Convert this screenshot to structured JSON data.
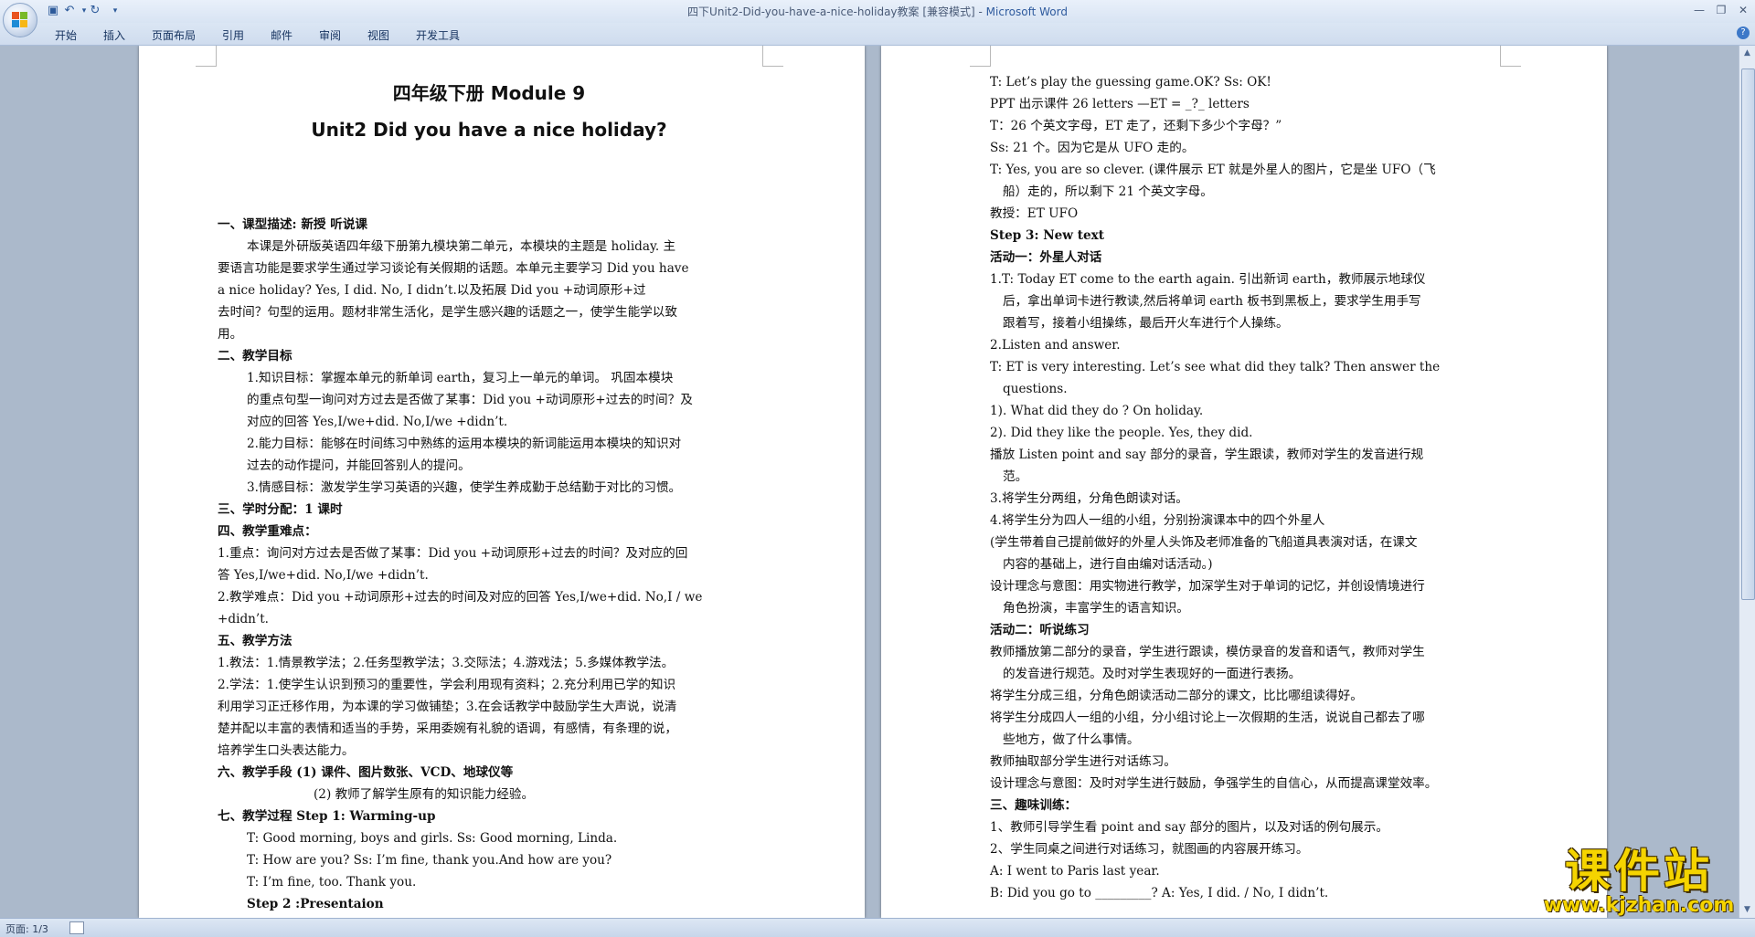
{
  "window": {
    "title": "四下Unit2-Did-you-have-a-nice-holiday教案 [兼容模式] - ",
    "app_name": "Microsoft Word"
  },
  "ribbon": {
    "tabs": [
      "开始",
      "插入",
      "页面布局",
      "引用",
      "邮件",
      "审阅",
      "视图",
      "开发工具"
    ]
  },
  "status": {
    "page_indicator": "页面: 1/3"
  },
  "watermark": {
    "text": "课件站",
    "url": "www.kjzhan.com"
  },
  "page1": {
    "title1": "四年级下册 Module 9",
    "title2": "Unit2 Did you have a nice holiday?",
    "lines": [
      {
        "t": "一、课型描述: 新授 听说课",
        "cls": "bold"
      },
      {
        "t": "本课是外研版英语四年级下册第九模块第二单元，本模块的主题是 holiday. 主",
        "cls": "indent1"
      },
      {
        "t": "要语言功能是要求学生通过学习谈论有关假期的话题。本单元主要学习 Did you have",
        "cls": ""
      },
      {
        "t": "a nice holiday?  Yes, I did.  No, I didn’t.以及拓展 Did you +动词原形+过",
        "cls": ""
      },
      {
        "t": "去时间？句型的运用。题材非常生活化，是学生感兴趣的话题之一，使学生能学以致",
        "cls": ""
      },
      {
        "t": "用。",
        "cls": ""
      },
      {
        "t": "二、教学目标",
        "cls": "bold"
      },
      {
        "t": "1.知识目标：掌握本单元的新单词 earth，复习上一单元的单词。  巩固本模块",
        "cls": "indent2"
      },
      {
        "t": "的重点句型一询问对方过去是否做了某事：Did you +动词原形+过去的时间？及",
        "cls": "indent2"
      },
      {
        "t": "对应的回答 Yes,I/we+did. No,I/we +didn’t.",
        "cls": "indent2"
      },
      {
        "t": "2.能力目标：能够在时间练习中熟练的运用本模块的新词能运用本模块的知识对",
        "cls": "indent2"
      },
      {
        "t": "过去的动作提问，并能回答别人的提问。",
        "cls": "indent2"
      },
      {
        "t": "3.情感目标：激发学生学习英语的兴趣，使学生养成勤于总结勤于对比的习惯。",
        "cls": "indent2"
      },
      {
        "t": "三、学时分配：1 课时",
        "cls": "bold"
      },
      {
        "t": "四、教学重难点：",
        "cls": "bold"
      },
      {
        "t": "1.重点：询问对方过去是否做了某事：Did you +动词原形+过去的时间？及对应的回",
        "cls": ""
      },
      {
        "t": "答 Yes,I/we+did. No,I/we +didn’t.",
        "cls": ""
      },
      {
        "t": "2.教学难点：Did you +动词原形+过去的时间及对应的回答 Yes,I/we+did. No,I / we",
        "cls": ""
      },
      {
        "t": "+didn’t.",
        "cls": ""
      },
      {
        "t": "五、教学方法",
        "cls": "bold"
      },
      {
        "t": "1.教法：1.情景教学法；2.任务型教学法；3.交际法；4.游戏法；5.多媒体教学法。",
        "cls": ""
      },
      {
        "t": "2.学法：1.使学生认识到预习的重要性，学会利用现有资料；2.充分利用已学的知识",
        "cls": ""
      },
      {
        "t": "利用学习正迁移作用，为本课的学习做铺垫；3.在会话教学中鼓励学生大声说，说清",
        "cls": ""
      },
      {
        "t": "楚并配以丰富的表情和适当的手势，采用委婉有礼貌的语调，有感情，有条理的说，",
        "cls": ""
      },
      {
        "t": "培养学生口头表达能力。",
        "cls": ""
      },
      {
        "t": "六、教学手段 (1) 课件、图片数张、VCD、地球仪等",
        "cls": "bold"
      },
      {
        "t": "(2) 教师了解学生原有的知识能力经验。",
        "cls": "indent3"
      },
      {
        "t": "七、教学过程 Step 1: Warming-up",
        "cls": "bold"
      },
      {
        "t": "T: Good morning, boys and girls.  Ss: Good morning, Linda.",
        "cls": "indent2"
      },
      {
        "t": "T: How are you?             Ss: I’m fine, thank you.And how are you?",
        "cls": "indent2"
      },
      {
        "t": "T: I’m fine, too. Thank you.",
        "cls": "indent2"
      },
      {
        "t": "Step 2 :Presentaion",
        "cls": "indent2 bold"
      }
    ]
  },
  "page2": {
    "lines": [
      {
        "t": "T: Let’s play the guessing game.OK?   Ss: OK!",
        "cls": ""
      },
      {
        "t": "PPT 出示课件 26 letters —ET = _?_ letters",
        "cls": ""
      },
      {
        "t": "T：26 个英文字母，ET 走了，还剩下多少个字母？”",
        "cls": ""
      },
      {
        "t": "Ss: 21 个。因为它是从 UFO 走的。",
        "cls": ""
      },
      {
        "t": "T: Yes, you are so clever. (课件展示 ET 就是外星人的图片，它是坐 UFO（飞",
        "cls": ""
      },
      {
        "t": "船）走的，所以剩下 21 个英文字母。",
        "cls": "hang"
      },
      {
        "t": "教授：ET  UFO",
        "cls": ""
      },
      {
        "t": "Step 3: New text",
        "cls": "bold"
      },
      {
        "t": "活动一：外星人对话",
        "cls": "bold"
      },
      {
        "t": "1.T: Today ET come to the earth again. 引出新词 earth，教师展示地球仪",
        "cls": ""
      },
      {
        "t": "后，拿出单词卡进行教读,然后将单词 earth 板书到黑板上，要求学生用手写",
        "cls": "hang"
      },
      {
        "t": "跟着写，接着小组操练，最后开火车进行个人操练。",
        "cls": "hang"
      },
      {
        "t": "2.Listen and answer.",
        "cls": ""
      },
      {
        "t": "T: ET is very interesting. Let’s see what did they talk? Then answer the",
        "cls": ""
      },
      {
        "t": "questions.",
        "cls": "hang"
      },
      {
        "t": "1). What did they do ?       On holiday.",
        "cls": ""
      },
      {
        "t": "2). Did they like the people.  Yes, they did.",
        "cls": ""
      },
      {
        "t": "播放 Listen point and say 部分的录音，学生跟读，教师对学生的发音进行规",
        "cls": ""
      },
      {
        "t": "范。",
        "cls": "hang"
      },
      {
        "t": "3.将学生分两组，分角色朗读对话。",
        "cls": ""
      },
      {
        "t": "4.将学生分为四人一组的小组，分别扮演课本中的四个外星人",
        "cls": ""
      },
      {
        "t": "(学生带着自己提前做好的外星人头饰及老师准备的飞船道具表演对话，在课文",
        "cls": ""
      },
      {
        "t": "内容的基础上，进行自由编对话活动。)",
        "cls": "hang"
      },
      {
        "t": "设计理念与意图：用实物进行教学，加深学生对于单词的记忆，并创设情境进行",
        "cls": ""
      },
      {
        "t": "角色扮演，丰富学生的语言知识。",
        "cls": "hang"
      },
      {
        "t": "活动二：听说练习",
        "cls": "bold"
      },
      {
        "t": "教师播放第二部分的录音，学生进行跟读，模仿录音的发音和语气，教师对学生",
        "cls": ""
      },
      {
        "t": "的发音进行规范。及时对学生表现好的一面进行表扬。",
        "cls": "hang"
      },
      {
        "t": "将学生分成三组，分角色朗读活动二部分的课文，比比哪组读得好。",
        "cls": ""
      },
      {
        "t": "将学生分成四人一组的小组，分小组讨论上一次假期的生活，说说自己都去了哪",
        "cls": ""
      },
      {
        "t": "些地方，做了什么事情。",
        "cls": "hang"
      },
      {
        "t": "教师抽取部分学生进行对话练习。",
        "cls": ""
      },
      {
        "t": "设计理念与意图：及时对学生进行鼓励，争强学生的自信心，从而提高课堂效率。",
        "cls": ""
      },
      {
        "t": "三、趣味训练：",
        "cls": "bold"
      },
      {
        "t": "1、教师引导学生看 point and say 部分的图片，以及对话的例句展示。",
        "cls": ""
      },
      {
        "t": "2、学生同桌之间进行对话练习，就图画的内容展开练习。",
        "cls": ""
      },
      {
        "t": "A: I went to  Paris last year.",
        "cls": ""
      },
      {
        "t": "B: Did you go to _________?          A: Yes, I did.  /  No, I didn’t.",
        "cls": ""
      }
    ]
  }
}
